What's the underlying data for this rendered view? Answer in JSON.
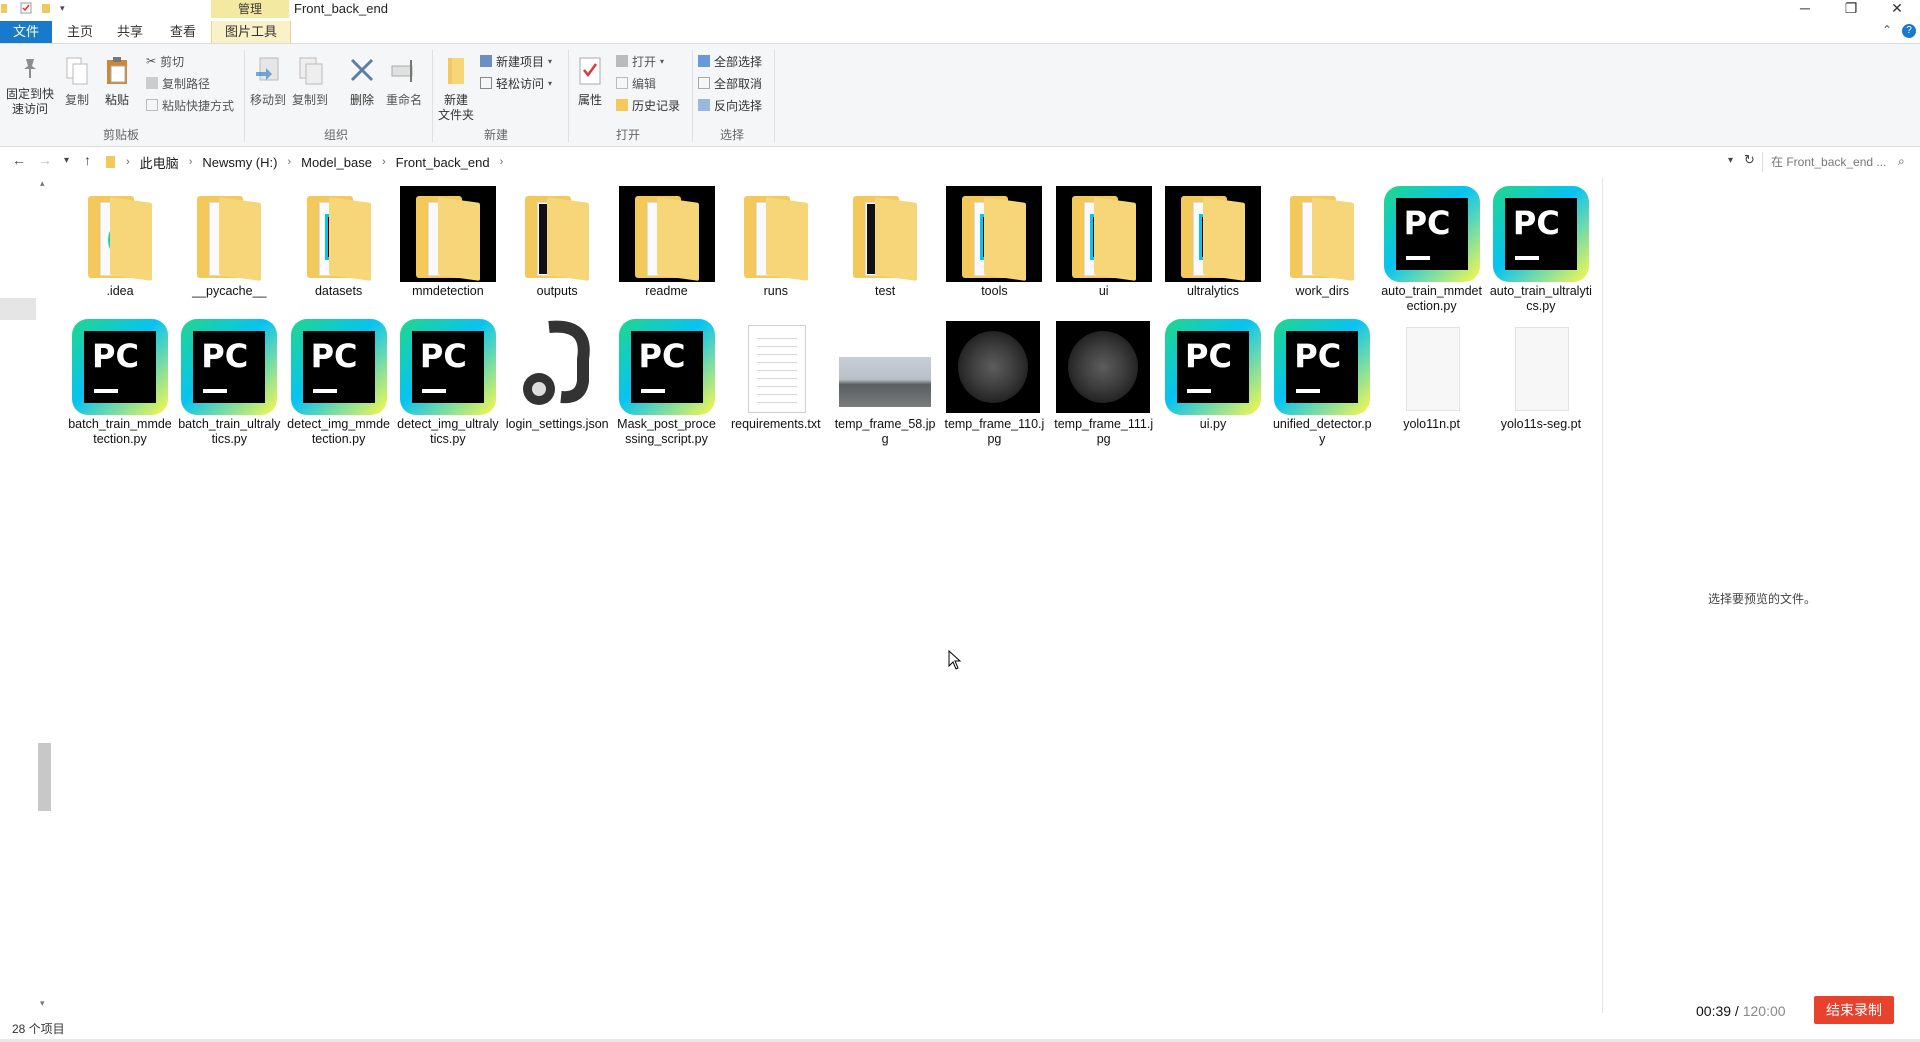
{
  "window": {
    "title": "Front_back_end",
    "context_tab": "管理",
    "controls": {
      "minimize": "─",
      "restore": "❐",
      "close": "✕"
    }
  },
  "tabs": [
    "文件",
    "主页",
    "共享",
    "查看",
    "图片工具"
  ],
  "ribbon": {
    "clipboard": {
      "pin_label": "固定到快\n速访问",
      "copy": "复制",
      "paste": "粘贴",
      "cut": "剪切",
      "copy_path": "复制路径",
      "paste_shortcut": "粘贴快捷方式",
      "group": "剪贴板"
    },
    "organize": {
      "move_to": "移动到",
      "copy_to": "复制到",
      "delete": "删除",
      "rename": "重命名",
      "group": "组织"
    },
    "new": {
      "new_folder": "新建\n文件夹",
      "new_item": "新建项目",
      "easy_access": "轻松访问",
      "group": "新建"
    },
    "open": {
      "properties": "属性",
      "open": "打开",
      "edit": "编辑",
      "history": "历史记录",
      "group": "打开"
    },
    "select": {
      "select_all": "全部选择",
      "select_none": "全部取消",
      "invert": "反向选择",
      "group": "选择"
    }
  },
  "address": {
    "crumbs": [
      "此电脑",
      "Newsmy (H:)",
      "Model_base",
      "Front_back_end"
    ],
    "search_placeholder": "在 Front_back_end ..."
  },
  "files": [
    {
      "name": ".idea",
      "kind": "folder-idea"
    },
    {
      "name": "__pycache__",
      "kind": "folder"
    },
    {
      "name": "datasets",
      "kind": "folder-pc"
    },
    {
      "name": "mmdetection",
      "kind": "folder-dark"
    },
    {
      "name": "outputs",
      "kind": "folder-scan"
    },
    {
      "name": "readme",
      "kind": "folder-dark"
    },
    {
      "name": "runs",
      "kind": "folder-doc"
    },
    {
      "name": "test",
      "kind": "folder-scan"
    },
    {
      "name": "tools",
      "kind": "folder-pc-dark"
    },
    {
      "name": "ui",
      "kind": "folder-pc-dark"
    },
    {
      "name": "ultralytics",
      "kind": "folder-pc-dark"
    },
    {
      "name": "work_dirs",
      "kind": "folder-doc"
    },
    {
      "name": "auto_train_mmdetection.py",
      "kind": "py"
    },
    {
      "name": "auto_train_ultralytics.py",
      "kind": "py"
    },
    {
      "name": "batch_train_mmdetection.py",
      "kind": "py"
    },
    {
      "name": "batch_train_ultralytics.py",
      "kind": "py"
    },
    {
      "name": "detect_img_mmdetection.py",
      "kind": "py"
    },
    {
      "name": "detect_img_ultralytics.py",
      "kind": "py"
    },
    {
      "name": "login_settings.json",
      "kind": "json"
    },
    {
      "name": "Mask_post_processing_script.py",
      "kind": "py"
    },
    {
      "name": "requirements.txt",
      "kind": "txt"
    },
    {
      "name": "temp_frame_58.jpg",
      "kind": "jpg-road"
    },
    {
      "name": "temp_frame_110.jpg",
      "kind": "jpg-brain"
    },
    {
      "name": "temp_frame_111.jpg",
      "kind": "jpg-brain"
    },
    {
      "name": "ui.py",
      "kind": "py"
    },
    {
      "name": "unified_detector.py",
      "kind": "py"
    },
    {
      "name": "yolo11n.pt",
      "kind": "pt"
    },
    {
      "name": "yolo11s-seg.pt",
      "kind": "pt"
    }
  ],
  "preview": {
    "message": "选择要预览的文件。"
  },
  "status": {
    "count": "28 个项目"
  },
  "recording": {
    "elapsed": "00:39",
    "separator": " / ",
    "total": "120:00",
    "end_button": "结束录制"
  },
  "colors": {
    "file_tab": "#1979ca",
    "manage_tab": "#f3e9a1",
    "end_record": "#e8412c"
  }
}
